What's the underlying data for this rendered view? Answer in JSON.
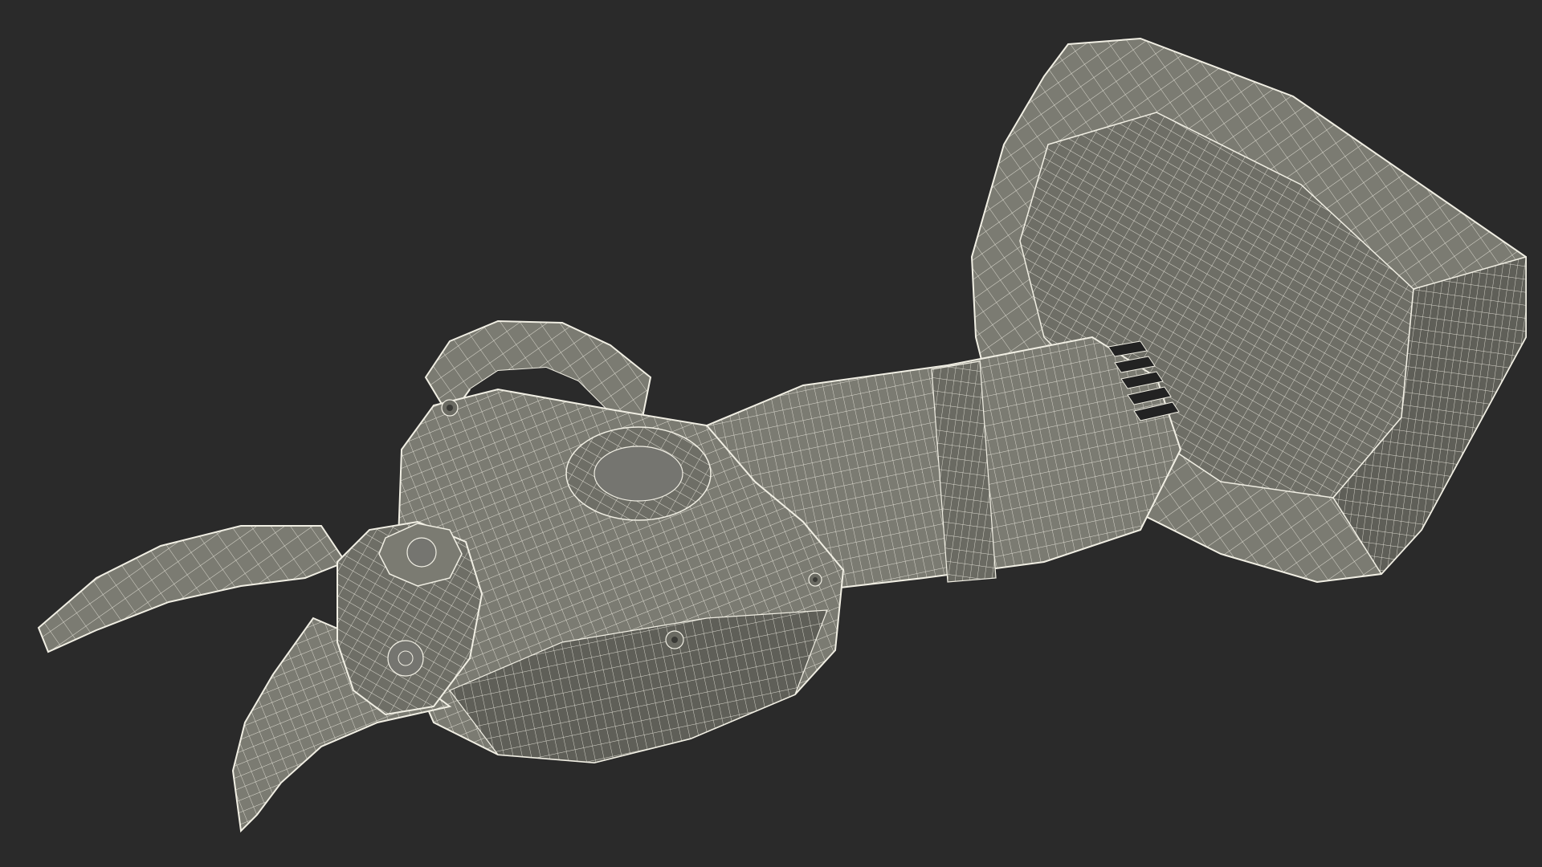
{
  "scene": {
    "background_color": "#2a2a2a",
    "mesh_fill_color": "#7b7b72",
    "mesh_shadow_color": "#5f5f58",
    "wire_color": "#f1efe4",
    "vent_color": "#222222"
  }
}
